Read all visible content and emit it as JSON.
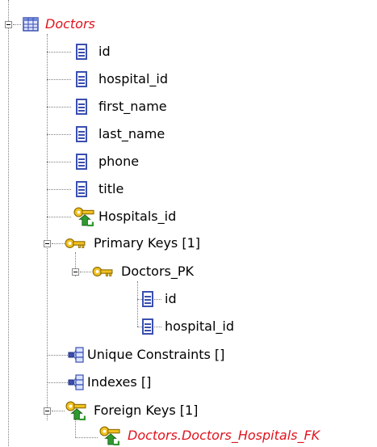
{
  "tree": {
    "table": {
      "label": "Doctors",
      "icon": "table-icon"
    },
    "columns": [
      {
        "label": "id",
        "icon": "column-icon"
      },
      {
        "label": "hospital_id",
        "icon": "column-icon"
      },
      {
        "label": "first_name",
        "icon": "column-icon"
      },
      {
        "label": "last_name",
        "icon": "column-icon"
      },
      {
        "label": "phone",
        "icon": "column-icon"
      },
      {
        "label": "title",
        "icon": "column-icon"
      }
    ],
    "fk_column": {
      "label": "Hospitals_id",
      "icon": "foreign-key-icon"
    },
    "primary_keys": {
      "label": "Primary Keys [1]",
      "icon": "key-icon",
      "key": {
        "label": "Doctors_PK",
        "icon": "key-icon",
        "columns": [
          {
            "label": "id",
            "icon": "column-icon"
          },
          {
            "label": "hospital_id",
            "icon": "column-icon"
          }
        ]
      }
    },
    "unique_constraints": {
      "label": "Unique Constraints []",
      "icon": "index-icon"
    },
    "indexes": {
      "label": "Indexes []",
      "icon": "index-icon"
    },
    "foreign_keys": {
      "label": "Foreign Keys [1]",
      "icon": "foreign-key-icon",
      "key": {
        "label": "Doctors.Doctors_Hospitals_FK",
        "icon": "foreign-key-icon"
      }
    }
  },
  "colors": {
    "error_red": "#e0141e",
    "icon_blue": "#3a4fb0",
    "key_yellow": "#f0c020",
    "fk_green": "#2e9a2e"
  }
}
